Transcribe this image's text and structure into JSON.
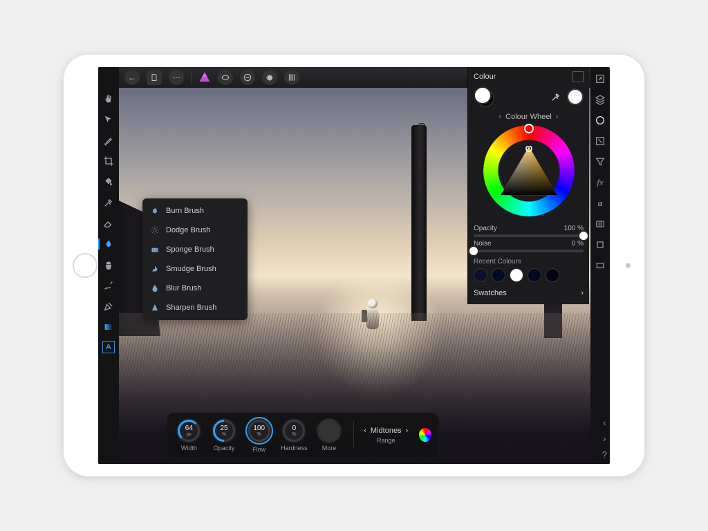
{
  "colour_panel": {
    "title": "Colour",
    "mode_label": "Colour Wheel",
    "opacity": {
      "label": "Opacity",
      "value_text": "100 %",
      "percent": 100
    },
    "noise": {
      "label": "Noise",
      "value_text": "0 %",
      "percent": 0
    },
    "recent_title": "Recent Colours",
    "recent": [
      "#0c1030",
      "#060a24",
      "#ffffff",
      "#050820",
      "#030516"
    ],
    "swatches_label": "Swatches"
  },
  "brush_flyout": {
    "items": [
      {
        "label": "Burn Brush",
        "icon": "flame"
      },
      {
        "label": "Dodge Brush",
        "icon": "sun"
      },
      {
        "label": "Sponge Brush",
        "icon": "sponge"
      },
      {
        "label": "Smudge Brush",
        "icon": "smudge"
      },
      {
        "label": "Blur Brush",
        "icon": "blur"
      },
      {
        "label": "Sharpen Brush",
        "icon": "sharpen"
      }
    ]
  },
  "context_bar": {
    "dials": [
      {
        "value": "64",
        "unit": "px",
        "label": "Width",
        "fill": 0.35
      },
      {
        "value": "25",
        "unit": "%",
        "label": "Opacity",
        "fill": 0.25
      },
      {
        "value": "100",
        "unit": "%",
        "label": "Flow",
        "fill": 1.0
      },
      {
        "value": "0",
        "unit": "%",
        "label": "Hardness",
        "fill": 0.0
      }
    ],
    "more_label": "More",
    "range": {
      "value": "Midtones",
      "label": "Range"
    }
  },
  "left_tools": [
    "hand",
    "move",
    "brush",
    "crop",
    "flood",
    "color-picker",
    "eraser",
    "burn",
    "clone",
    "retouch",
    "pen",
    "gradient",
    "text"
  ],
  "right_studio": [
    "pop-out",
    "layers",
    "colour",
    "adjust",
    "filters",
    "fx",
    "text-style",
    "stock",
    "transform",
    "nav"
  ],
  "corner": {
    "help": "?"
  }
}
